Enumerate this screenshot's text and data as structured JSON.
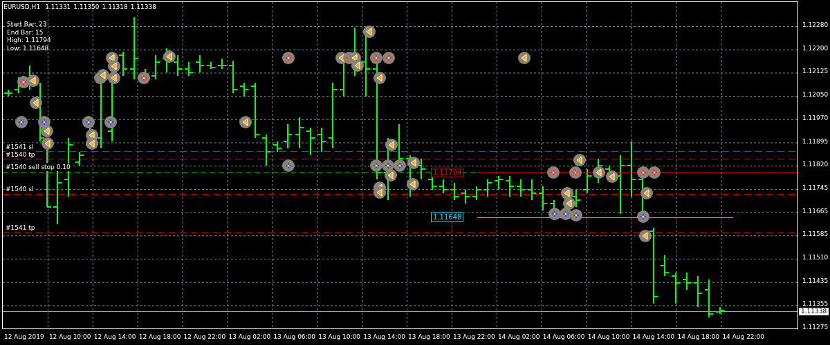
{
  "header": {
    "symbol": "EURUSD,H1",
    "prices": [
      "1.11331",
      "1.11350",
      "1.11318",
      "1.11338"
    ]
  },
  "info_lines": [
    "Start Bar: 23",
    "End Bar: 15",
    "High: 1.11794",
    "Low: 1.11648"
  ],
  "order_lines": [
    {
      "label": "#1541 sl",
      "kind": "sl"
    },
    {
      "label": "#1540 tp",
      "kind": "tp"
    },
    {
      "label": "#1540 sell stop 0.10",
      "kind": "entry"
    },
    {
      "label": "#1540 sl",
      "kind": "sl"
    },
    {
      "label": "#1541 tp",
      "kind": "tp"
    }
  ],
  "price_tags": [
    {
      "text": "1.11794",
      "kind": "high"
    },
    {
      "text": "1.11648",
      "kind": "low"
    }
  ],
  "price_axis": {
    "labels": [
      "1.12280",
      "1.12200",
      "1.12125",
      "1.12050",
      "1.11970",
      "1.11895",
      "1.11820",
      "1.11745",
      "1.11665",
      "1.11585",
      "1.11510",
      "1.11435",
      "1.11355",
      "1.11275"
    ],
    "current": "1.11338"
  },
  "time_axis": {
    "labels": [
      "12 Aug 2019",
      "12 Aug 10:00",
      "12 Aug 14:00",
      "12 Aug 18:00",
      "12 Aug 22:00",
      "13 Aug 02:00",
      "13 Aug 06:00",
      "13 Aug 10:00",
      "13 Aug 14:00",
      "13 Aug 18:00",
      "13 Aug 22:00",
      "14 Aug 02:00",
      "14 Aug 06:00",
      "14 Aug 10:00",
      "14 Aug 14:00",
      "14 Aug 18:00",
      "14 Aug 22:00"
    ]
  }
}
